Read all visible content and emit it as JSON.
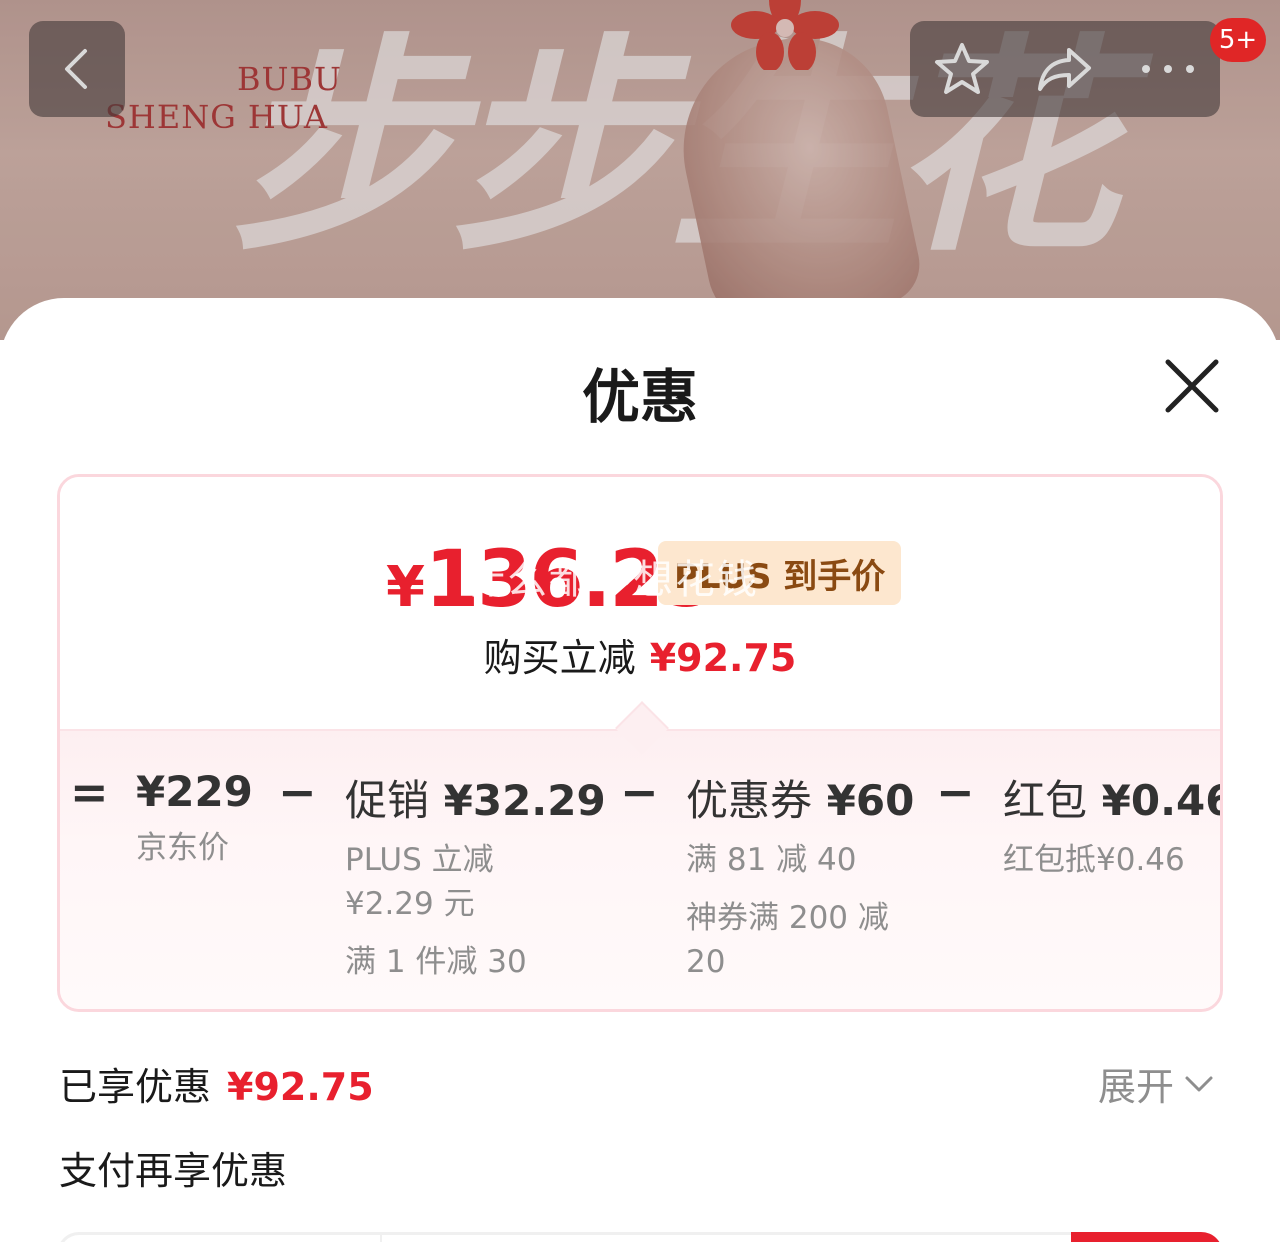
{
  "banner": {
    "brand_line1": "BUBU",
    "brand_line2": "SHENG HUA",
    "brush_text": "步步生花"
  },
  "topbar": {
    "back_icon": "chevron-left-icon",
    "star_icon": "star-icon",
    "share_icon": "share-icon",
    "more_icon": "more-icon",
    "badge": "5+"
  },
  "sheet": {
    "title": "优惠",
    "close_icon": "close-icon"
  },
  "price_card": {
    "final_price_symbol": "¥",
    "final_price_value": "136.25",
    "price_type_tag": "PLUS 到手价",
    "watermark": "什么都不想花钱",
    "save_label": "购买立减",
    "save_amount": "¥92.75"
  },
  "breakdown": {
    "equals": "=",
    "minus": "−",
    "jd_price": {
      "main": "¥229",
      "label": "京东价"
    },
    "promo": {
      "title": "促销",
      "amount": "¥32.29",
      "lines": [
        "PLUS 立减",
        "¥2.29 元",
        "满 1 件减 30"
      ]
    },
    "coupon": {
      "title": "优惠券",
      "amount": "¥60",
      "lines": [
        "满 81 减 40",
        "神券满 200 减",
        "20"
      ]
    },
    "redpacket": {
      "title": "红包",
      "amount": "¥0.46",
      "lines": [
        "红包抵¥0.46"
      ]
    }
  },
  "footer": {
    "enjoyed_label": "已享优惠",
    "enjoyed_amount": "¥92.75",
    "expand_label": "展开",
    "pay_more_label": "支付再享优惠"
  },
  "colors": {
    "accent_red": "#e8202e",
    "plus_tag_bg": "#fde7cf",
    "plus_tag_text": "#8a4a12"
  }
}
